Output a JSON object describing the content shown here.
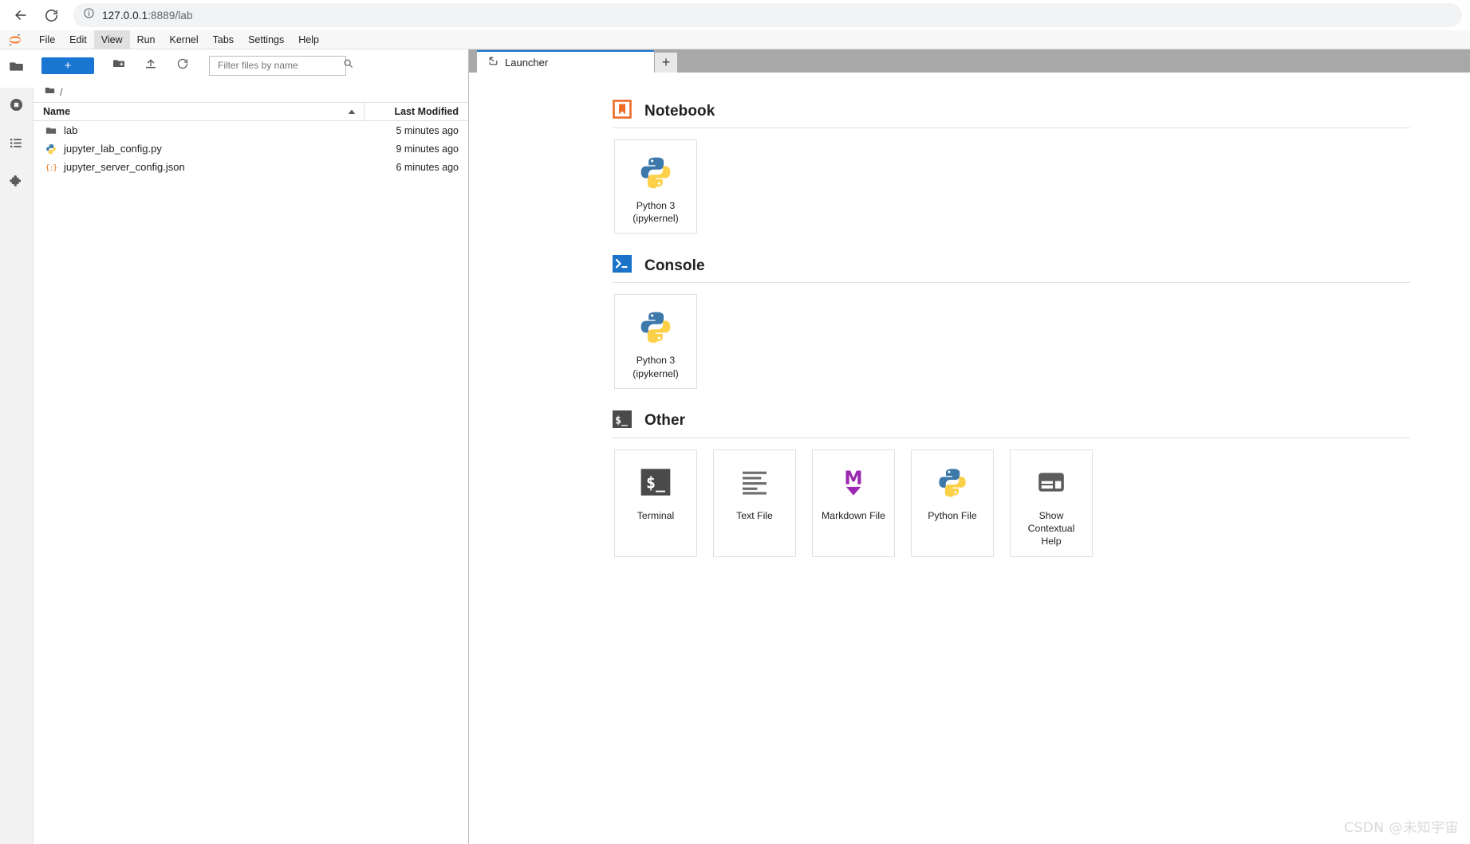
{
  "browser": {
    "back_label": "Back",
    "reload_label": "Reload",
    "url_host": "127.0.0.1",
    "url_rest": ":8889/lab",
    "url_full": "127.0.0.1:8889/lab"
  },
  "menubar": {
    "logo": "jupyter-logo-icon",
    "items": [
      {
        "label": "File",
        "active": false
      },
      {
        "label": "Edit",
        "active": false
      },
      {
        "label": "View",
        "active": true
      },
      {
        "label": "Run",
        "active": false
      },
      {
        "label": "Kernel",
        "active": false
      },
      {
        "label": "Tabs",
        "active": false
      },
      {
        "label": "Settings",
        "active": false
      },
      {
        "label": "Help",
        "active": false
      }
    ]
  },
  "left_rail": {
    "items": [
      {
        "name": "file-browser",
        "icon": "folder-icon",
        "active": true
      },
      {
        "name": "running-terminals-kernels",
        "icon": "stop-circle-icon",
        "active": false
      },
      {
        "name": "table-of-contents",
        "icon": "list-icon",
        "active": false
      },
      {
        "name": "extension-manager",
        "icon": "puzzle-icon",
        "active": false
      }
    ]
  },
  "filebrowser": {
    "new_launcher_label": "+",
    "new_folder_icon": "new-folder-icon",
    "upload_icon": "upload-icon",
    "refresh_icon": "refresh-icon",
    "filter_placeholder": "Filter files by name",
    "filter_value": "",
    "search_icon": "search-icon",
    "breadcrumb_root": "/",
    "columns": [
      "Name",
      "Last Modified"
    ],
    "sort_indicator": "ascending",
    "rows": [
      {
        "icon": "folder-icon",
        "name": "lab",
        "modified": "5 minutes ago"
      },
      {
        "icon": "python-file-icon",
        "name": "jupyter_lab_config.py",
        "modified": "9 minutes ago"
      },
      {
        "icon": "json-file-icon",
        "name": "jupyter_server_config.json",
        "modified": "6 minutes ago"
      }
    ]
  },
  "dock": {
    "tabs": [
      {
        "label": "Launcher",
        "icon": "launcher-icon",
        "active": true
      }
    ],
    "add_tab_label": "+"
  },
  "launcher": {
    "sections": [
      {
        "title": "Notebook",
        "icon": "notebook-icon",
        "cards": [
          {
            "label": "Python 3\n(ipykernel)",
            "icon": "python-icon"
          }
        ]
      },
      {
        "title": "Console",
        "icon": "console-icon",
        "cards": [
          {
            "label": "Python 3\n(ipykernel)",
            "icon": "python-icon"
          }
        ]
      },
      {
        "title": "Other",
        "icon": "terminal-icon",
        "cards": [
          {
            "label": "Terminal",
            "icon": "terminal-icon"
          },
          {
            "label": "Text File",
            "icon": "text-file-icon"
          },
          {
            "label": "Markdown File",
            "icon": "markdown-icon"
          },
          {
            "label": "Python File",
            "icon": "python-icon"
          },
          {
            "label": "Show\nContextual\nHelp",
            "icon": "contextual-help-icon"
          }
        ]
      }
    ]
  },
  "watermark": {
    "text": "CSDN @未知宇宙"
  },
  "colors": {
    "accent_blue": "#1976d2",
    "notebook_orange": "#ee6b29",
    "console_blue": "#1a73c8",
    "terminal_dark": "#4a4a4a",
    "markdown_purple": "#9c27b0",
    "tabbar_gray": "#a8a8a8"
  }
}
